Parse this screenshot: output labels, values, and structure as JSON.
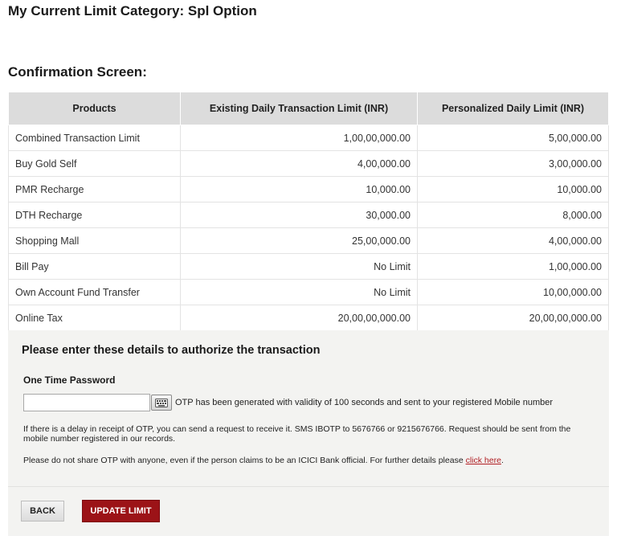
{
  "page_title": "My Current Limit Category: Spl Option",
  "section_title": "Confirmation Screen:",
  "table": {
    "headers": [
      "Products",
      "Existing Daily Transaction Limit (INR)",
      "Personalized Daily Limit (INR)"
    ],
    "rows": [
      [
        "Combined Transaction Limit",
        "1,00,00,000.00",
        "5,00,000.00"
      ],
      [
        "Buy Gold Self",
        "4,00,000.00",
        "3,00,000.00"
      ],
      [
        "PMR Recharge",
        "10,000.00",
        "10,000.00"
      ],
      [
        "DTH Recharge",
        "30,000.00",
        "8,000.00"
      ],
      [
        "Shopping Mall",
        "25,00,000.00",
        "4,00,000.00"
      ],
      [
        "Bill Pay",
        "No Limit",
        "1,00,000.00"
      ],
      [
        "Own Account Fund Transfer",
        "No Limit",
        "10,00,000.00"
      ],
      [
        "Online Tax",
        "20,00,00,000.00",
        "20,00,00,000.00"
      ]
    ]
  },
  "auth": {
    "heading": "Please enter these details to authorize the transaction",
    "otp_label": "One Time Password",
    "otp_value": "",
    "keyboard_icon": "keyboard-icon",
    "otp_note": "OTP has been generated with validity of 100 seconds and sent to your registered Mobile number",
    "delay_note": "If there is a delay in receipt of OTP, you can send a request to receive it. SMS IBOTP to 5676766 or 9215676766. Request should be sent from the mobile number registered in our records.",
    "share_note": "Please do not share OTP with anyone, even if the person claims to be an ICICI Bank official. For further details please ",
    "click_here": "click here",
    "share_note_end": "."
  },
  "buttons": {
    "back": "BACK",
    "update": "UPDATE LIMIT"
  },
  "colors": {
    "accent": "#9c1317",
    "link": "#b01e23",
    "header_bg": "#dcdcdc",
    "panel_bg": "#f3f3f1"
  }
}
